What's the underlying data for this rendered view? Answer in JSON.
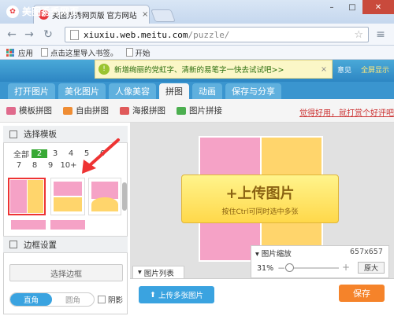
{
  "browser": {
    "tab_title": "美图秀秀网页版 官方网站",
    "tab_close": "×",
    "url_host": "xiuxiu.web.meitu.com",
    "url_path": "/puzzle/",
    "bookmarks": [
      {
        "label": "应用"
      },
      {
        "label": "点击这里导入书签。"
      },
      {
        "label": "开始"
      }
    ]
  },
  "app": {
    "logo": "美图秀秀网页",
    "notice": "新增绚丽的党虹字、清新的易笔字一快去试试吧>>",
    "feedback": "意见",
    "fullscreen": "全屏显示"
  },
  "main_tabs": [
    {
      "label": "打开图片",
      "active": false
    },
    {
      "label": "美化图片",
      "active": false
    },
    {
      "label": "人像美容",
      "active": false
    },
    {
      "label": "拼图",
      "active": true
    },
    {
      "label": "动画",
      "active": false
    },
    {
      "label": "保存与分享",
      "active": false
    }
  ],
  "sub_tools": [
    {
      "label": "模板拼图",
      "icon": "template-icon",
      "color": "#e06a8c"
    },
    {
      "label": "自由拼图",
      "icon": "free-icon",
      "color": "#ef8d34"
    },
    {
      "label": "海报拼图",
      "icon": "poster-icon",
      "color": "#e05a5a"
    },
    {
      "label": "图片拼接",
      "icon": "join-icon",
      "color": "#4caf50"
    }
  ],
  "praise_link": "觉得好用，就打赏个好评吧",
  "left_panel": {
    "title": "选择模板",
    "pager_row1": [
      "全部",
      "2",
      "3",
      "4",
      "5",
      "6"
    ],
    "pager_row2": [
      "7",
      "8",
      "9",
      "10+"
    ],
    "selected": "2",
    "border_settings": "边框设置",
    "choose_border": "选择边框",
    "corner_on": "直角",
    "corner_off": "圆角",
    "shadow": "阴影"
  },
  "canvas": {
    "upload_title": "+上传图片",
    "upload_sub": "按住Ctrl可同时选中多张",
    "zoom_label": "图片缩放",
    "zoom_size": "657x657",
    "zoom_pct": "31%",
    "zoom_value": 0.04,
    "zoom_orig": "原大",
    "list_tab": "图片列表",
    "upload_multi": "上传多张图片",
    "save": "保存"
  },
  "colors": {
    "pink": "#f5a2c6",
    "yellow": "#ffd56c",
    "accent": "#3aa3e0",
    "arrow": "#e33"
  }
}
